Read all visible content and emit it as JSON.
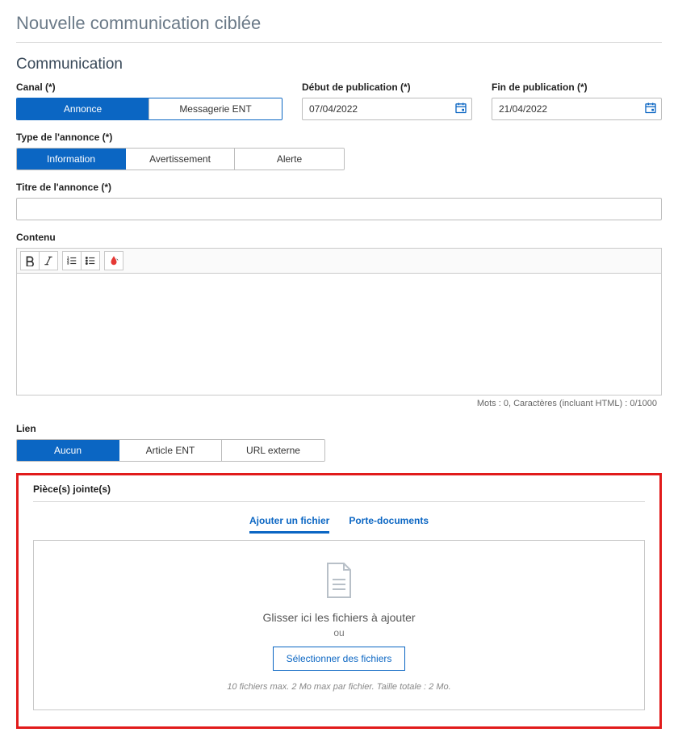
{
  "page": {
    "title": "Nouvelle communication ciblée"
  },
  "section": {
    "title": "Communication"
  },
  "canal": {
    "label": "Canal (*)",
    "options": {
      "annonce": "Annonce",
      "messagerie": "Messagerie ENT"
    }
  },
  "dates": {
    "start_label": "Début de publication (*)",
    "start_value": "07/04/2022",
    "end_label": "Fin de publication (*)",
    "end_value": "21/04/2022"
  },
  "type": {
    "label": "Type de l'annonce (*)",
    "options": {
      "information": "Information",
      "avertissement": "Avertissement",
      "alerte": "Alerte"
    }
  },
  "titre": {
    "label": "Titre de l'annonce (*)",
    "value": ""
  },
  "contenu": {
    "label": "Contenu",
    "counter": "Mots : 0, Caractères (incluant HTML) : 0/1000"
  },
  "lien": {
    "label": "Lien",
    "options": {
      "aucun": "Aucun",
      "article": "Article ENT",
      "url": "URL externe"
    }
  },
  "attachments": {
    "label": "Pièce(s) jointe(s)",
    "tabs": {
      "ajouter": "Ajouter un fichier",
      "porte": "Porte-documents"
    },
    "drop_text": "Glisser ici les fichiers à ajouter",
    "or": "ou",
    "select_btn": "Sélectionner des fichiers",
    "limits": "10 fichiers max. 2 Mo max par fichier. Taille totale : 2 Mo."
  }
}
